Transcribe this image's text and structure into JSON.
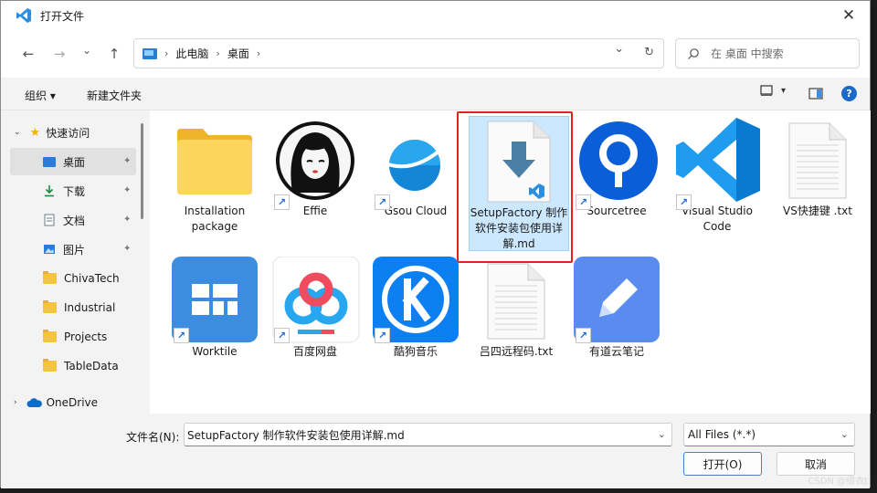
{
  "window": {
    "title": "打开文件",
    "close_glyph": "✕"
  },
  "nav": {
    "back_glyph": "←",
    "forward_glyph": "→",
    "recent_glyph": "⌄",
    "up_glyph": "↑",
    "breadcrumb": [
      "此电脑",
      "桌面"
    ],
    "crumb_sep": "›",
    "dropdown_glyph": "⌄",
    "refresh_glyph": "↻",
    "search_placeholder": "在 桌面 中搜索"
  },
  "commands": {
    "organize": "组织 ▾",
    "new_folder": "新建文件夹",
    "view_dd": "▾",
    "help": "?"
  },
  "sidebar": {
    "quick_access": "快速访问",
    "items": [
      {
        "label": "桌面",
        "icon": "desktop-icon",
        "pinned": true,
        "selected": true
      },
      {
        "label": "下载",
        "icon": "download-icon",
        "pinned": true
      },
      {
        "label": "文档",
        "icon": "document-icon",
        "pinned": true
      },
      {
        "label": "图片",
        "icon": "picture-icon",
        "pinned": true
      },
      {
        "label": "ChivaTech",
        "icon": "folder-icon"
      },
      {
        "label": "Industrial",
        "icon": "folder-icon"
      },
      {
        "label": "Projects",
        "icon": "folder-icon"
      },
      {
        "label": "TableData",
        "icon": "folder-icon"
      }
    ],
    "onedrive": "OneDrive",
    "pin_glyph": "📌"
  },
  "files": [
    {
      "name": "Installation package",
      "icon": "folder-icon",
      "shortcut": false
    },
    {
      "name": "Effie",
      "icon": "effie-app-icon",
      "shortcut": true
    },
    {
      "name": "Gsou Cloud",
      "icon": "gsou-cloud-icon",
      "shortcut": true
    },
    {
      "name": "SetupFactory 制作软件安装包使用详解.md",
      "icon": "markdown-file-icon",
      "shortcut": false,
      "selected": true
    },
    {
      "name": "Sourcetree",
      "icon": "sourcetree-icon",
      "shortcut": true
    },
    {
      "name": "Visual Studio Code",
      "icon": "vscode-icon",
      "shortcut": true
    },
    {
      "name": "VS快捷键 .txt",
      "icon": "text-file-icon",
      "shortcut": false
    },
    {
      "name": "Worktile",
      "icon": "worktile-icon",
      "shortcut": true
    },
    {
      "name": "百度网盘",
      "icon": "baidu-netdisk-icon",
      "shortcut": true
    },
    {
      "name": "酷狗音乐",
      "icon": "kugou-music-icon",
      "shortcut": true
    },
    {
      "name": "吕四远程码.txt",
      "icon": "text-file-icon",
      "shortcut": false
    },
    {
      "name": "有道云笔记",
      "icon": "youdao-note-icon",
      "shortcut": true
    }
  ],
  "footer": {
    "filename_label": "文件名(N):",
    "filename_value": "SetupFactory 制作软件安装包使用详解.md",
    "filetype_value": "All Files (*.*)",
    "open_label": "打开(O)",
    "cancel_label": "取消"
  },
  "watermark": "CSDN @缀衣t"
}
